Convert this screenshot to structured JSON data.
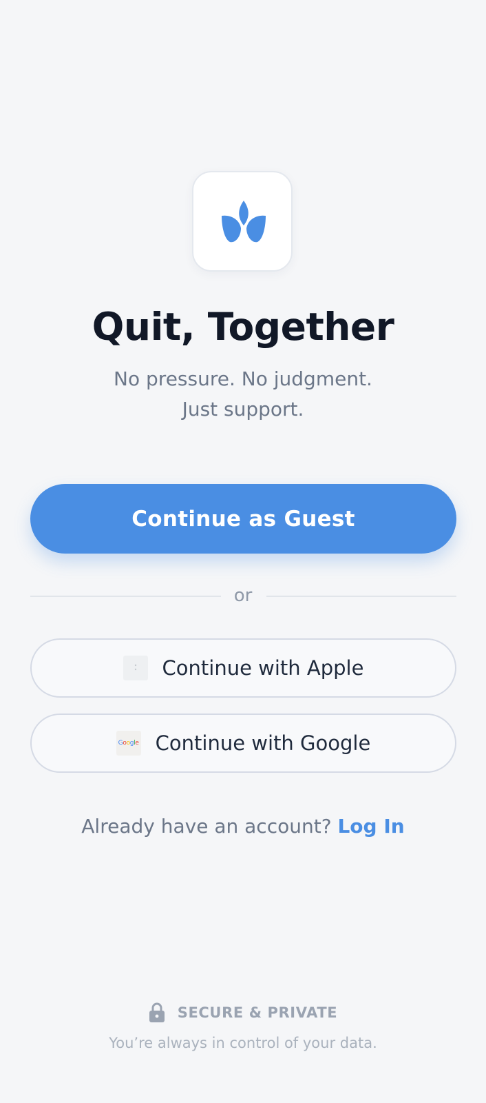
{
  "colors": {
    "accent": "#4a8ee3",
    "background": "#f5f6f8",
    "title": "#111827",
    "muted_text": "#6b7688"
  },
  "logo": {
    "icon": "sprout-leaf-icon"
  },
  "header": {
    "title": "Quit, Together",
    "subtitle_line1": "No pressure. No judgment.",
    "subtitle_line2": "Just support."
  },
  "actions": {
    "guest_label": "Continue as Guest",
    "divider_text": "or",
    "apple_label": "Continue with Apple",
    "apple_icon": "apple-logo-icon",
    "google_label": "Continue with Google",
    "google_icon": "google-logo-icon",
    "google_icon_text": "Google"
  },
  "login": {
    "prompt": "Already have an account?",
    "link_label": "Log In"
  },
  "footer": {
    "secure_label": "SECURE & PRIVATE",
    "secure_icon": "lock-icon",
    "secure_sub": "You’re always in control of your data."
  }
}
